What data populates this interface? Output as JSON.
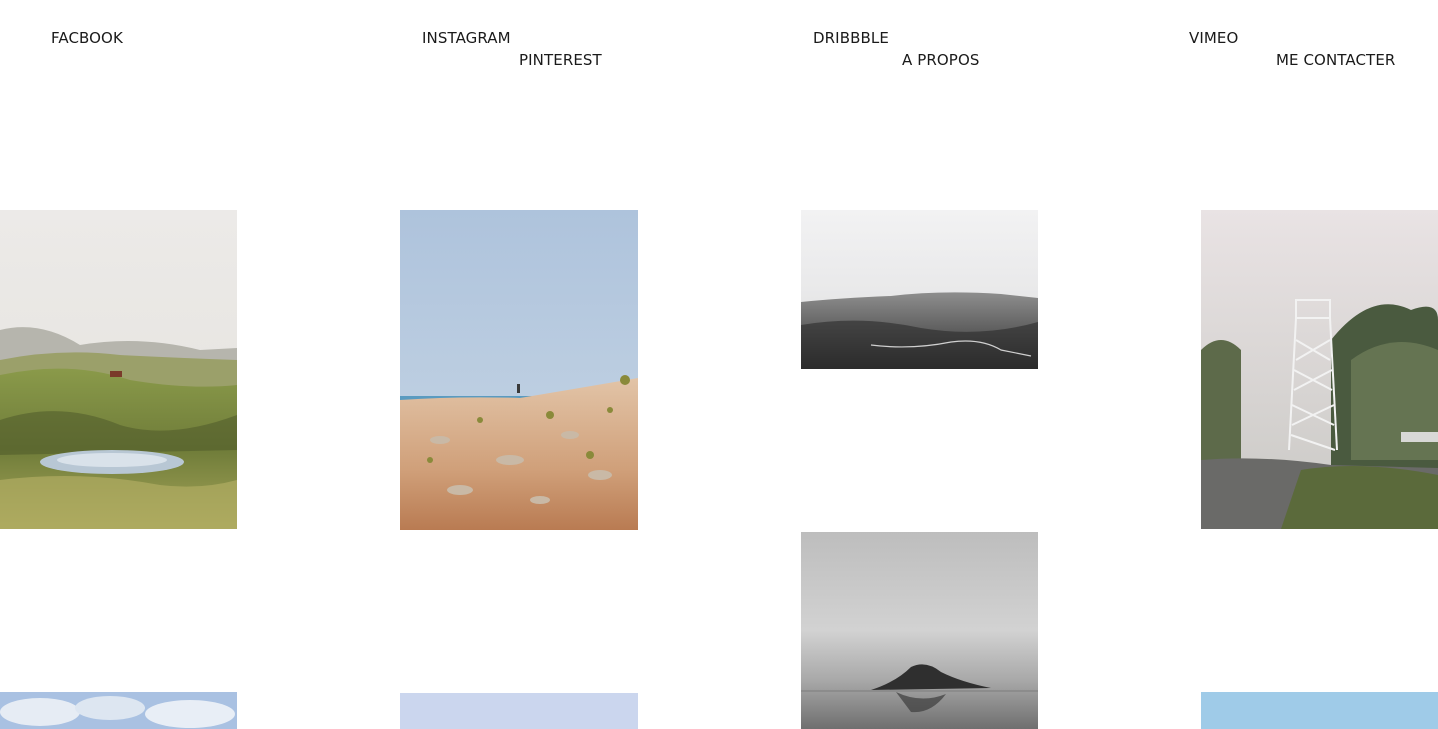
{
  "nav": {
    "facebook": "FACBOOK",
    "instagram": "INSTAGRAM",
    "pinterest": "PINTEREST",
    "dribbble": "DRIBBBLE",
    "about": "A PROPOS",
    "vimeo": "VIMEO",
    "contact": "ME CONTACTER"
  },
  "gallery": {
    "photos": [
      {
        "name": "green-hills-pond-photo"
      },
      {
        "name": "desert-dune-hiker-photo"
      },
      {
        "name": "misty-valley-bw-photo"
      },
      {
        "name": "fire-lookout-tower-photo"
      },
      {
        "name": "foggy-rock-sea-bw-photo"
      },
      {
        "name": "cloudy-sky-photo"
      },
      {
        "name": "pale-blue-sky-photo"
      },
      {
        "name": "clear-blue-sky-photo"
      }
    ]
  },
  "colors": {
    "text": "#1a1a1a",
    "background": "#ffffff"
  }
}
